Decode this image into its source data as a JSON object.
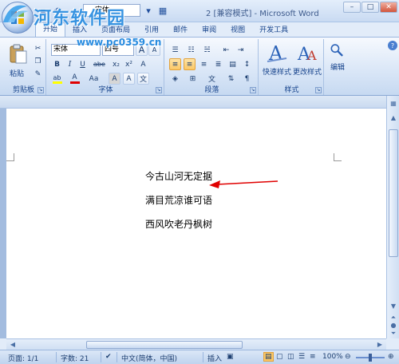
{
  "window": {
    "title": "2 [兼容模式] - Microsoft Word",
    "font_quick": "宋体"
  },
  "tabs": [
    "开始",
    "插入",
    "页面布局",
    "引用",
    "邮件",
    "审阅",
    "视图",
    "开发工具"
  ],
  "ribbon": {
    "clipboard": {
      "label": "剪贴板",
      "paste": "粘贴"
    },
    "font": {
      "label": "字体",
      "font_name": "宋体",
      "font_size": "四号",
      "bold": "B",
      "italic": "I",
      "underline": "U",
      "strike": "abe",
      "subscript": "x₂",
      "superscript": "x²",
      "grow": "A",
      "shrink": "A",
      "change_case": "Aa",
      "clear": "A",
      "char_border": "A",
      "char_shading": "A",
      "font_color": "A",
      "highlight": "ab"
    },
    "paragraph": {
      "label": "段落"
    },
    "styles": {
      "label": "样式",
      "quick": "快速样式",
      "change": "更改样式"
    },
    "editing": {
      "label": "编辑"
    }
  },
  "document": {
    "lines": [
      "今古山河无定据",
      "满目荒凉谁可语",
      "西风吹老丹枫树"
    ]
  },
  "status_bar": {
    "page": "页面: 1/1",
    "words": "字数: 21",
    "language": "中文(简体，中国)",
    "mode": "插入",
    "zoom": "100%"
  },
  "watermark": {
    "text": "河东软件园",
    "url": "www.pc0359.cn"
  },
  "colors": {
    "accent": "#15428b",
    "ribbon_bg": "#d9e6f7",
    "arrow": "#e00000",
    "font_color_underline": "#e00000",
    "highlight_underline": "#ffff00"
  }
}
